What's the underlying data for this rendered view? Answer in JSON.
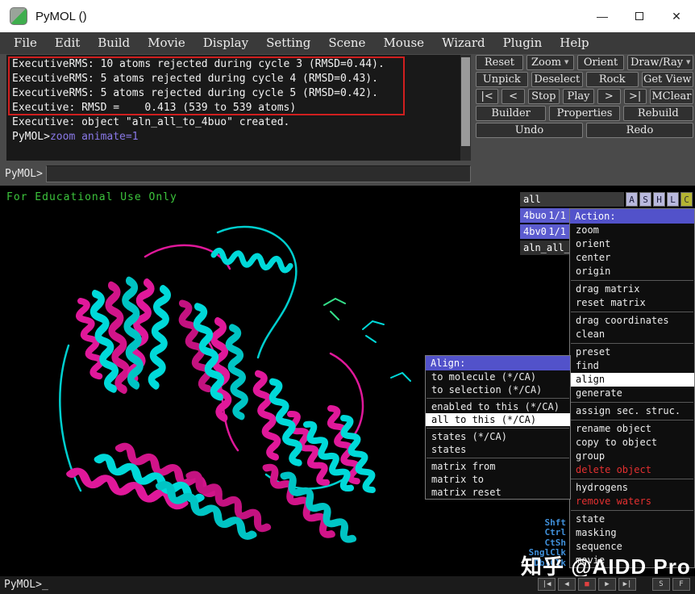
{
  "titlebar": {
    "title": "PyMOL ()",
    "minimize_glyph": "—",
    "close_glyph": "✕"
  },
  "menubar": {
    "items": [
      "File",
      "Edit",
      "Build",
      "Movie",
      "Display",
      "Setting",
      "Scene",
      "Mouse",
      "Wizard",
      "Plugin",
      "Help"
    ]
  },
  "console": {
    "rms1": "ExecutiveRMS: 10 atoms rejected during cycle 3 (RMSD=0.44).",
    "rms2": "ExecutiveRMS: 5 atoms rejected during cycle 4 (RMSD=0.43).",
    "rms3": "ExecutiveRMS: 5 atoms rejected during cycle 5 (RMSD=0.42).",
    "rms4": "Executive: RMSD =    0.413 (539 to 539 atoms)",
    "created": "Executive: object \"aln_all_to_4buo\" created.",
    "prompt": "PyMOL>",
    "command": "zoom animate=1"
  },
  "cmdline": {
    "prompt": "PyMOL>"
  },
  "controls": {
    "reset": "Reset",
    "zoom": "Zoom",
    "orient": "Orient",
    "draw_ray": "Draw/Ray",
    "unpick": "Unpick",
    "deselect": "Deselect",
    "rock": "Rock",
    "get_view": "Get View",
    "first": "|<",
    "prev": "<",
    "stop": "Stop",
    "play": "Play",
    "next": ">",
    "last": ">|",
    "mclear": "MClear",
    "builder": "Builder",
    "properties": "Properties",
    "rebuild": "Rebuild",
    "undo": "Undo",
    "redo": "Redo",
    "dropdown": "▼"
  },
  "viewport": {
    "watermark": "For Educational Use Only",
    "brand": "知乎 @AIDD Pro"
  },
  "objects": {
    "all_label": "all",
    "buttons": {
      "a": "A",
      "s": "S",
      "h": "H",
      "l": "L",
      "c": "C"
    },
    "rows": [
      {
        "name": "4buo",
        "state": "1/1"
      },
      {
        "name": "4bv0",
        "state": "1/1"
      },
      {
        "name": "aln_all_",
        "state": ""
      }
    ]
  },
  "action_menu": {
    "title": "Action:",
    "items": [
      "zoom",
      "orient",
      "center",
      "origin",
      "drag matrix",
      "reset matrix",
      "drag coordinates",
      "clean",
      "preset",
      "find",
      "align",
      "generate",
      "assign sec. struc.",
      "rename object",
      "copy to object",
      "group",
      "delete object",
      "hydrogens",
      "remove waters",
      "state",
      "masking",
      "sequence",
      "movie"
    ]
  },
  "align_menu": {
    "title": "Align:",
    "items": [
      "to molecule (*/CA)",
      "to selection (*/CA)",
      "enabled to this (*/CA)",
      "all to this (*/CA)",
      "states (*/CA)",
      "states",
      "matrix from",
      "matrix to",
      "matrix reset"
    ]
  },
  "mouse_legend": {
    "labels": [
      "Shft",
      "Ctrl",
      "CtSh",
      "SnglClk",
      "DblClk"
    ]
  },
  "statusbar": {
    "prompt": "PyMOL>_",
    "vcr": [
      "|◀",
      "◀",
      "■",
      "▶",
      "▶|"
    ],
    "s": "S",
    "f": "F"
  },
  "colors": {
    "protein_magenta": "#e0189a",
    "protein_cyan": "#00d9d9",
    "annotation_red": "#d01f1f",
    "menu_header_purple": "#5252ca",
    "object_row_purple": "#5c5ccf",
    "edu_green": "#3cc43c",
    "command_purple": "#8a79e8"
  }
}
